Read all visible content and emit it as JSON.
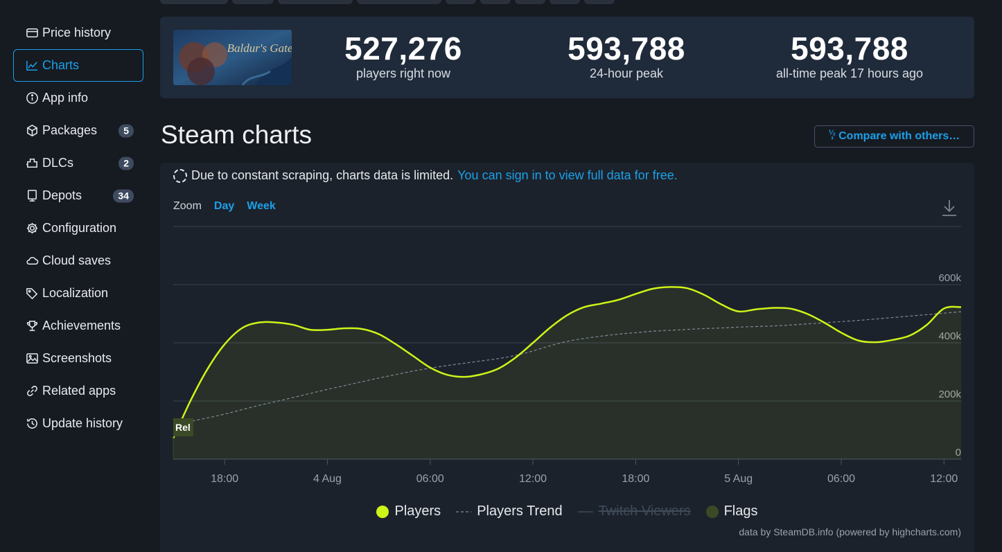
{
  "sidebar": {
    "items": [
      {
        "label": "Price history",
        "icon": "wallet-icon"
      },
      {
        "label": "Charts",
        "icon": "chart-line-icon",
        "active": true
      },
      {
        "label": "App info",
        "icon": "info-icon"
      },
      {
        "label": "Packages",
        "icon": "package-icon",
        "badge": "5"
      },
      {
        "label": "DLCs",
        "icon": "dlc-icon",
        "badge": "2"
      },
      {
        "label": "Depots",
        "icon": "depot-icon",
        "badge": "34"
      },
      {
        "label": "Configuration",
        "icon": "gear-icon"
      },
      {
        "label": "Cloud saves",
        "icon": "cloud-icon"
      },
      {
        "label": "Localization",
        "icon": "tag-icon"
      },
      {
        "label": "Achievements",
        "icon": "trophy-icon"
      },
      {
        "label": "Screenshots",
        "icon": "image-icon"
      },
      {
        "label": "Related apps",
        "icon": "link-icon"
      },
      {
        "label": "Update history",
        "icon": "history-icon"
      }
    ]
  },
  "header": {
    "game_logo_text": "Baldur's Gate",
    "stats": [
      {
        "value": "527,276",
        "label": "players right now"
      },
      {
        "value": "593,788",
        "label": "24-hour peak"
      },
      {
        "value": "593,788",
        "label": "all-time peak 17 hours ago"
      }
    ]
  },
  "page": {
    "title": "Steam charts",
    "compare_label": "Compare with others…"
  },
  "chart_card": {
    "notice_text": "Due to constant scraping, charts data is limited.",
    "notice_link": "You can sign in to view full data for free.",
    "zoom_label": "Zoom",
    "zoom_options": [
      "Day",
      "Week"
    ],
    "flag_label": "Rel",
    "credits": "data by SteamDB.info (powered by highcharts.com)"
  },
  "chart_data": {
    "type": "area",
    "x": [
      "3 Aug 15:00",
      "3 Aug 16:00",
      "3 Aug 17:00",
      "3 Aug 18:00",
      "3 Aug 19:00",
      "3 Aug 20:00",
      "3 Aug 21:00",
      "3 Aug 22:00",
      "3 Aug 23:00",
      "4 Aug 00:00",
      "4 Aug 01:00",
      "4 Aug 02:00",
      "4 Aug 03:00",
      "4 Aug 04:00",
      "4 Aug 05:00",
      "4 Aug 06:00",
      "4 Aug 07:00",
      "4 Aug 08:00",
      "4 Aug 09:00",
      "4 Aug 10:00",
      "4 Aug 11:00",
      "4 Aug 12:00",
      "4 Aug 13:00",
      "4 Aug 14:00",
      "4 Aug 15:00",
      "4 Aug 16:00",
      "4 Aug 17:00",
      "4 Aug 18:00",
      "4 Aug 19:00",
      "4 Aug 20:00",
      "4 Aug 21:00",
      "4 Aug 22:00",
      "4 Aug 23:00",
      "5 Aug 00:00",
      "5 Aug 01:00",
      "5 Aug 02:00",
      "5 Aug 03:00",
      "5 Aug 04:00",
      "5 Aug 05:00",
      "5 Aug 06:00",
      "5 Aug 07:00",
      "5 Aug 08:00",
      "5 Aug 09:00",
      "5 Aug 10:00",
      "5 Aug 11:00",
      "5 Aug 12:00",
      "5 Aug 13:00"
    ],
    "series": [
      {
        "name": "Players",
        "color": "#cef418",
        "values": [
          72000,
          200000,
          310000,
          395000,
          450000,
          470000,
          470000,
          462000,
          445000,
          445000,
          450000,
          448000,
          430000,
          395000,
          355000,
          315000,
          290000,
          283000,
          292000,
          312000,
          350000,
          400000,
          452000,
          495000,
          523000,
          535000,
          548000,
          568000,
          586000,
          592000,
          588000,
          565000,
          532000,
          508000,
          515000,
          520000,
          518000,
          500000,
          470000,
          435000,
          408000,
          402000,
          410000,
          425000,
          462000,
          518000,
          523000
        ]
      },
      {
        "name": "Players Trend",
        "color": "#7f8a98",
        "values": [
          120000,
          130000,
          142000,
          155000,
          170000,
          185000,
          198000,
          212000,
          226000,
          240000,
          253000,
          266000,
          279000,
          291000,
          303000,
          313000,
          322000,
          330000,
          338000,
          346000,
          357000,
          372000,
          390000,
          405000,
          415000,
          423000,
          430000,
          435000,
          440000,
          443000,
          446000,
          449000,
          451000,
          454000,
          456000,
          458000,
          461000,
          465000,
          469000,
          473000,
          477000,
          482000,
          487000,
          492000,
          497000,
          502000,
          507000
        ]
      },
      {
        "name": "Twitch Viewers",
        "visible": false
      },
      {
        "name": "Flags",
        "color": "#3b4a26"
      }
    ],
    "x_ticks": [
      "18:00",
      "4 Aug",
      "06:00",
      "12:00",
      "18:00",
      "5 Aug",
      "06:00",
      "12:00"
    ],
    "y_ticks": [
      "0",
      "200k",
      "400k",
      "600k"
    ],
    "ylim": [
      0,
      800000
    ],
    "legend": "bottom-center",
    "grid": true
  }
}
